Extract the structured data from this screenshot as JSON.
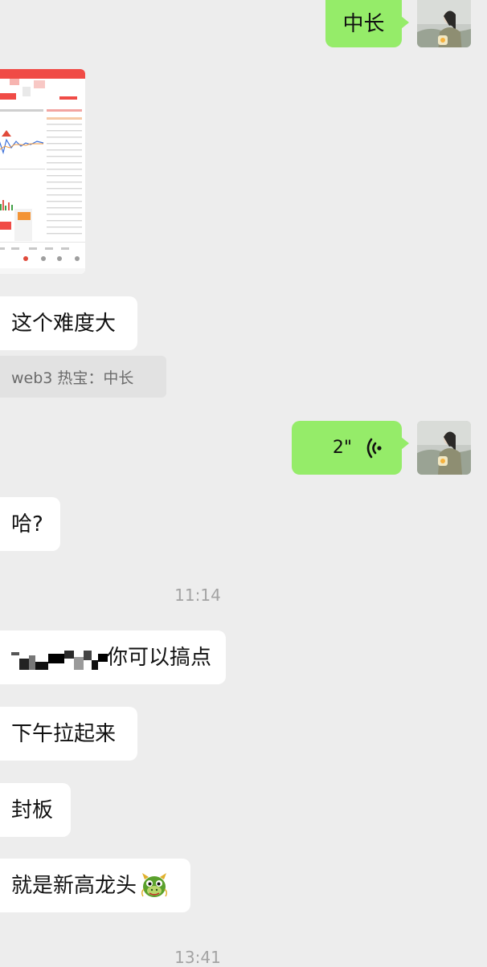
{
  "messages": {
    "m1_text": "中长",
    "m2_text": "这个难度大",
    "m2_quote": "web3 热宝：中长",
    "voice_duration": "2\"",
    "m3_text": "哈?",
    "time1": "11:14",
    "m4_text": "你可以搞点",
    "m5_text": "下午拉起来",
    "m6_text": "封板",
    "m7_text": "就是新高龙头",
    "time2": "13:41"
  },
  "icons": {
    "voice": "voice-wave-icon",
    "dragon": "dragon-emoji-icon"
  },
  "colors": {
    "background": "#ededed",
    "self_bubble": "#95ec69",
    "other_bubble": "#ffffff",
    "timestamp": "#a3a3a3"
  }
}
